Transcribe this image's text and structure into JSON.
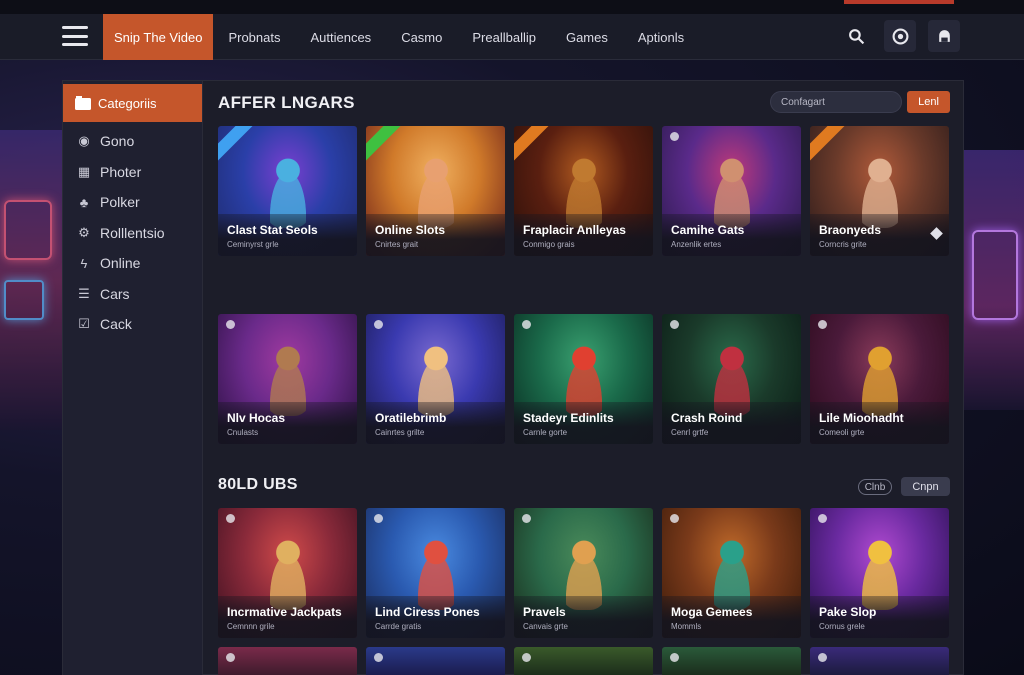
{
  "topbar": {
    "nav": [
      "Snip The Video",
      "Probnats",
      "Auttiences",
      "Casmo",
      "Preallballip",
      "Games",
      "Aptionls"
    ],
    "icons": [
      "search-icon",
      "target-icon",
      "user-icon"
    ]
  },
  "sidebar": {
    "header": "Categoriis",
    "items": [
      {
        "label": "Gono",
        "icon": "chip-icon"
      },
      {
        "label": "Photer",
        "icon": "grid-icon"
      },
      {
        "label": "Polker",
        "icon": "cards-icon"
      },
      {
        "label": "Rolllentsio",
        "icon": "wheel-icon"
      },
      {
        "label": "Online",
        "icon": "lightning-icon"
      },
      {
        "label": "Cars",
        "icon": "list-icon"
      },
      {
        "label": "Cack",
        "icon": "check-icon"
      }
    ]
  },
  "section1": {
    "title": "AFFER LNGARS",
    "search_placeholder": "Confagart",
    "button": "Lenl",
    "cards": [
      {
        "name": "Clast Stat Seols",
        "sub": "Ceminyrst grle",
        "ribbon": "#3fa0f0",
        "art": [
          "#2a3fa8",
          "#7a3fd0",
          "#1e2a6a"
        ],
        "fig": "#4ab0e0"
      },
      {
        "name": "Online Slots",
        "sub": "Cnirtes grait",
        "ribbon": "#3fc040",
        "art": [
          "#d07a2a",
          "#f0b060",
          "#6a1f1a"
        ],
        "fig": "#e8a070"
      },
      {
        "name": "Fraplacir Anlleyas",
        "sub": "Conmigo grais",
        "ribbon": "#e07a20",
        "art": [
          "#5a1f10",
          "#b05a20",
          "#2a0f0a"
        ],
        "fig": "#c07a30"
      },
      {
        "name": "Camihe Gats",
        "sub": "Anzenlik ertes",
        "ribbon": "",
        "art": [
          "#5a2a8a",
          "#c03a7a",
          "#2a1a4a"
        ],
        "fig": "#d09070"
      },
      {
        "name": "Braonyeds",
        "sub": "Corncris grite",
        "ribbon": "#e07a20",
        "art": [
          "#6a3a2a",
          "#b05a3a",
          "#2a1a1a"
        ],
        "fig": "#e0b090"
      }
    ]
  },
  "section1b": {
    "cards": [
      {
        "name": "Nlv Hocas",
        "sub": "Cnulasts",
        "art": [
          "#6a2a8a",
          "#a03aa0",
          "#2a1040"
        ],
        "fig": "#b07a50"
      },
      {
        "name": "Oratilebrimb",
        "sub": "Cainrtes grilte",
        "art": [
          "#3a3ab0",
          "#7a6ad0",
          "#1a1a50"
        ],
        "fig": "#f0c080"
      },
      {
        "name": "Stadeyr Edinlits",
        "sub": "Carnle gorte",
        "art": [
          "#1a6a4a",
          "#3aa070",
          "#0a2a20"
        ],
        "fig": "#e04030"
      },
      {
        "name": "Crash Roind",
        "sub": "Cenrl grtfe",
        "art": [
          "#1a3a2a",
          "#2a6a4a",
          "#0a1a14"
        ],
        "fig": "#c03040"
      },
      {
        "name": "Lile Mioohadht",
        "sub": "Comeoli grte",
        "art": [
          "#4a1a3a",
          "#8a3a5a",
          "#2a0a1a"
        ],
        "fig": "#e0a030"
      }
    ]
  },
  "section2": {
    "title": "80LD UBS",
    "pill_a": "Clnb",
    "pill_b": "Cnpn",
    "cards": [
      {
        "name": "Incrmative Jackpats",
        "sub": "Cemnnn grile",
        "art": [
          "#8a2a3a",
          "#d04a4a",
          "#3a1020"
        ],
        "fig": "#e0b060"
      },
      {
        "name": "Lind Ciress Pones",
        "sub": "Carrde gratis",
        "art": [
          "#2a5ab0",
          "#4a8ae0",
          "#1a2a5a"
        ],
        "fig": "#e05040"
      },
      {
        "name": "Pravels",
        "sub": "Canvais grte",
        "art": [
          "#2a6a4a",
          "#4a8a5a",
          "#1a2a1a"
        ],
        "fig": "#e0a050"
      },
      {
        "name": "Moga Gemees",
        "sub": "Mommls",
        "art": [
          "#7a3a1a",
          "#c06a2a",
          "#3a1a0a"
        ],
        "fig": "#2aa08a"
      },
      {
        "name": "Pake Slop",
        "sub": "Cornus grele",
        "art": [
          "#6a2aa0",
          "#b04ad0",
          "#2a1050"
        ],
        "fig": "#f0c040"
      }
    ]
  },
  "section3": {
    "cards": [
      {
        "art": [
          "#7a2a4a",
          "#3a1a2a"
        ]
      },
      {
        "art": [
          "#2a3a8a",
          "#1a1a4a"
        ]
      },
      {
        "art": [
          "#3a5a2a",
          "#1a2a1a"
        ]
      },
      {
        "art": [
          "#2a5a3a",
          "#1a2a1a"
        ]
      },
      {
        "art": [
          "#3a2a7a",
          "#1a1a3a"
        ]
      }
    ]
  },
  "colors": {
    "accent": "#c5562b",
    "panel": "#1c1d29",
    "sidebar": "#1f2030"
  }
}
